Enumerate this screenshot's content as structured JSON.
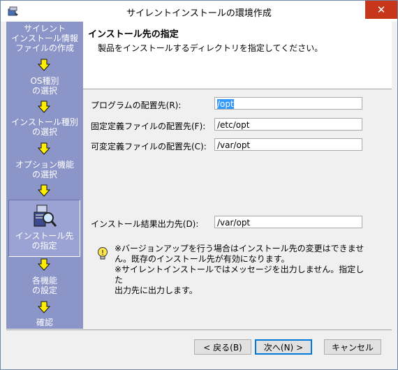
{
  "window": {
    "title": "サイレントインストールの環境作成",
    "close_glyph": "✕"
  },
  "sidebar": {
    "steps": [
      "サイレント\nインストール情報\nファイルの作成",
      "OS種別\nの選択",
      "インストール種別\nの選択",
      "オプション機能\nの選択",
      "インストール先\nの指定",
      "各機能\nの設定",
      "確認"
    ],
    "current_index": 4,
    "arrow_color": "#ffee00"
  },
  "header": {
    "title": "インストール先の指定",
    "subtitle": "製品をインストールするディレクトリを指定してください。"
  },
  "fields": [
    {
      "label": "プログラムの配置先(R):",
      "value": "/opt",
      "selected": true
    },
    {
      "label": "固定定義ファイルの配置先(F):",
      "value": "/etc/opt"
    },
    {
      "label": "可変定義ファイルの配置先(C):",
      "value": "/var/opt"
    },
    {
      "label": "インストール結果出力先(D):",
      "value": "/var/opt"
    }
  ],
  "info": {
    "lines": [
      "※バージョンアップを行う場合はインストール先の変更はできませ",
      "ん。既存のインストール先が有効になります。",
      "※サイレントインストールではメッセージを出力しません。指定した",
      "出力先に出力します。"
    ]
  },
  "buttons": {
    "back": "< 戻る(B)",
    "next": "次へ(N) >",
    "cancel": "キャンセル"
  }
}
